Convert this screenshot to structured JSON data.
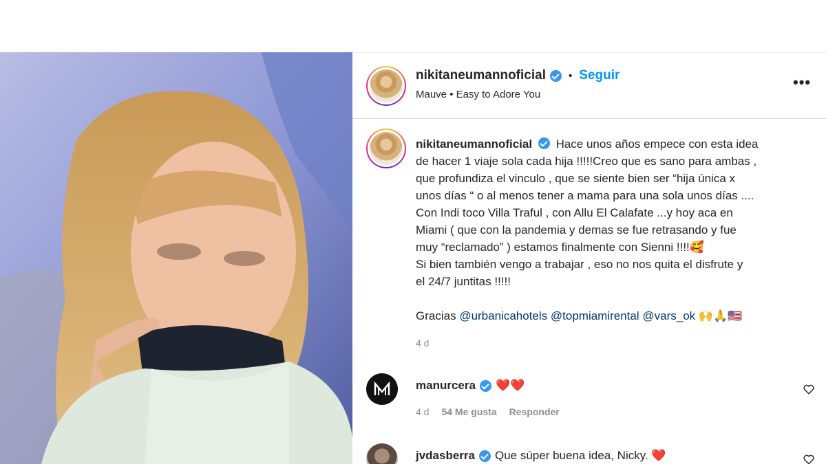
{
  "post": {
    "username": "nikitaneumannoficial",
    "separator": "•",
    "follow_label": "Seguir",
    "audio": "Mauve • Easy to Adore You",
    "more_label": "•••"
  },
  "caption": {
    "username": "nikitaneumannoficial",
    "text_lines": [
      "Hace unos años empece con esta idea",
      "de hacer 1 viaje sola cada hija !!!!!Creo que es sano para ambas ,",
      "que profundiza el vinculo , que se siente bien ser “hija única x",
      "unos días “ o al menos tener a mama para una sola unos días ....",
      "Con Indi toco Villa Traful , con Allu El Calafate ...y hoy aca en",
      "Miami ( que con la pandemia y demas se fue retrasando y fue",
      "muy “reclamado” ) estamos finalmente con Sienni !!!!🥰",
      "Si bien también vengo a trabajar , eso no nos quita el disfrute y",
      "el 24/7 juntitas !!!!!"
    ],
    "thanks_prefix": "Gracias",
    "mentions": [
      "@urbanicahotels",
      "@topmiamirental",
      "@vars_ok"
    ],
    "thanks_emojis": "🙌🙏🇺🇸",
    "time": "4 d"
  },
  "comments": [
    {
      "username": "manurcera",
      "text": "❤️❤️",
      "time": "4 d",
      "likes": "54 Me gusta",
      "reply_label": "Responder"
    },
    {
      "username": "jvdasberra",
      "text": "Que súper buena idea, Nicky. ❤️"
    }
  ],
  "colors": {
    "accent": "#0095f6",
    "verified": "#3897f0",
    "muted": "#8e8e8e",
    "text": "#262626",
    "heart_red": "#ed4956"
  }
}
